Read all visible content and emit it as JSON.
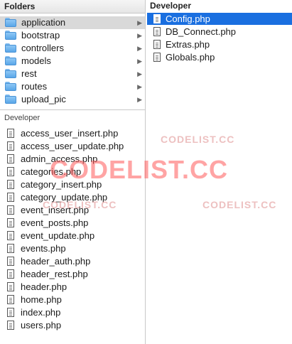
{
  "left_pane": {
    "header": "Folders",
    "folders": [
      {
        "label": "application",
        "selected": true
      },
      {
        "label": "bootstrap",
        "selected": false
      },
      {
        "label": "controllers",
        "selected": false
      },
      {
        "label": "models",
        "selected": false
      },
      {
        "label": "rest",
        "selected": false
      },
      {
        "label": "routes",
        "selected": false
      },
      {
        "label": "upload_pic",
        "selected": false
      }
    ],
    "section_title": "Developer",
    "files": [
      "access_user_insert.php",
      "access_user_update.php",
      "admin_access.php",
      "categories.php",
      "category_insert.php",
      "category_update.php",
      "event_insert.php",
      "event_posts.php",
      "event_update.php",
      "events.php",
      "header_auth.php",
      "header_rest.php",
      "header.php",
      "home.php",
      "index.php",
      "users.php"
    ]
  },
  "right_pane": {
    "header": "Developer",
    "files": [
      {
        "label": "Config.php",
        "selected": true
      },
      {
        "label": "DB_Connect.php",
        "selected": false
      },
      {
        "label": "Extras.php",
        "selected": false
      },
      {
        "label": "Globals.php",
        "selected": false
      }
    ]
  },
  "watermarks": {
    "big": "CODELIST.CC",
    "small": "CODELIST.CC"
  },
  "icons": {
    "folder": "folder-icon",
    "file": "file-icon",
    "chevron": "chevron-right-icon"
  },
  "colors": {
    "folder_blue": "#5aa6e8",
    "selection_blue": "#1a6fe0",
    "selected_folder_bg": "#d9d9d9"
  }
}
